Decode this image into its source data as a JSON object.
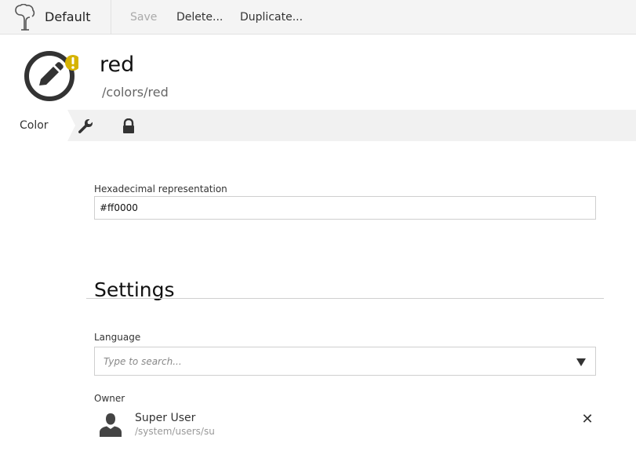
{
  "toolbar": {
    "brand": "Default",
    "save_label": "Save",
    "delete_label": "Delete...",
    "duplicate_label": "Duplicate..."
  },
  "header": {
    "title": "red",
    "path": "/colors/red",
    "status_icon": "warning-badge",
    "doc_icon": "pencil-icon"
  },
  "tabs": [
    {
      "label": "Color",
      "active": true
    },
    {
      "icon": "wrench-icon"
    },
    {
      "icon": "lock-icon"
    }
  ],
  "form": {
    "hex_label": "Hexadecimal representation",
    "hex_value": "#ff0000"
  },
  "settings": {
    "title": "Settings",
    "language_label": "Language",
    "language_placeholder": "Type to search...",
    "owner_label": "Owner",
    "owner_name": "Super User",
    "owner_path": "/system/users/su"
  },
  "colors": {
    "toolbar_bg": "#f4f4f4",
    "tabbar_bg": "#f1f1f1",
    "warning": "#d6b300",
    "icon_dark": "#333333"
  }
}
